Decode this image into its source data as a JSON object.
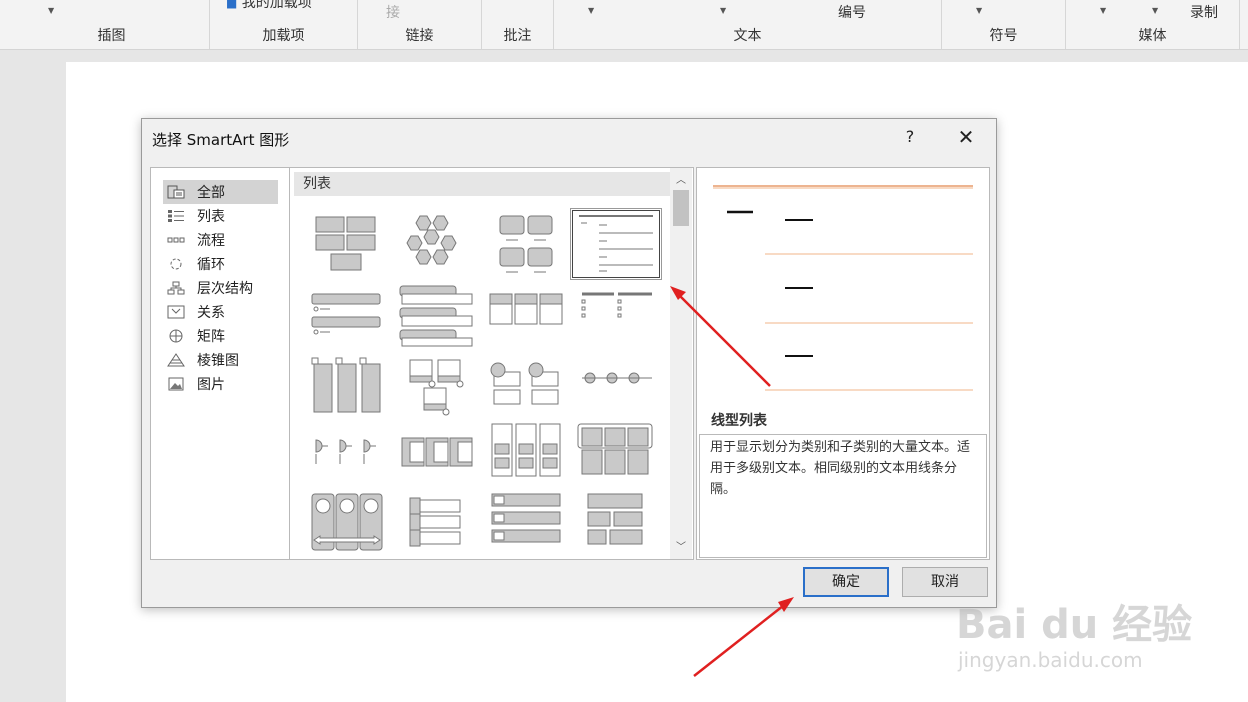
{
  "ribbon": {
    "groups": [
      {
        "label": "插图"
      },
      {
        "label": "加载项",
        "top": "我的加载项"
      },
      {
        "label": "链接",
        "top": "接"
      },
      {
        "label": "批注"
      },
      {
        "label": "文本",
        "top": "编号"
      },
      {
        "label": "符号"
      },
      {
        "label": "媒体",
        "top": "录制"
      }
    ]
  },
  "dialog": {
    "title": "选择 SmartArt 图形",
    "help": "?",
    "close": "✕",
    "categories": [
      {
        "label": "全部",
        "icon": "all-icon",
        "selected": true
      },
      {
        "label": "列表",
        "icon": "list-icon"
      },
      {
        "label": "流程",
        "icon": "process-icon"
      },
      {
        "label": "循环",
        "icon": "cycle-icon"
      },
      {
        "label": "层次结构",
        "icon": "hierarchy-icon"
      },
      {
        "label": "关系",
        "icon": "relationship-icon"
      },
      {
        "label": "矩阵",
        "icon": "matrix-icon"
      },
      {
        "label": "棱锥图",
        "icon": "pyramid-icon"
      },
      {
        "label": "图片",
        "icon": "picture-icon"
      }
    ],
    "gallery_header": "列表",
    "preview": {
      "name": "线型列表",
      "description": "用于显示划分为类别和子类别的大量文本。适用于多级别文本。相同级别的文本用线条分隔。"
    },
    "ok": "确定",
    "cancel": "取消"
  },
  "watermark": {
    "logo": "Bai du 经验",
    "url": "jingyan.baidu.com"
  },
  "colors": {
    "accent": "#2a6fc9",
    "arrow": "#e02020",
    "preview_line": "#f2b48a"
  }
}
